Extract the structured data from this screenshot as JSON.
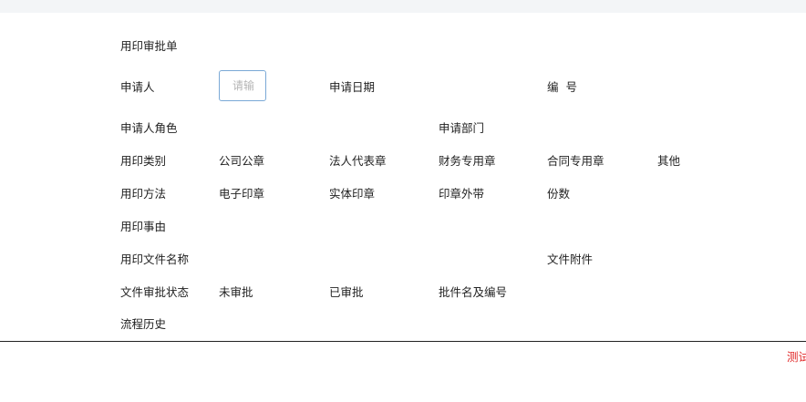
{
  "form": {
    "title": "用印审批单",
    "applicant_label": "申请人",
    "applicant_input": {
      "placeholder": "请输",
      "value": ""
    },
    "apply_date_label": "申请日期",
    "number_label": "编  号",
    "applicant_role_label": "申请人角色",
    "apply_dept_label": "申请部门",
    "seal_type": {
      "label": "用印类别",
      "options": [
        "公司公章",
        "法人代表章",
        "财务专用章",
        "合同专用章",
        "其他"
      ]
    },
    "seal_method": {
      "label": "用印方法",
      "options": [
        "电子印章",
        "实体印章",
        "印章外带"
      ]
    },
    "copies_label": "份数",
    "reason_label": "用印事由",
    "doc_name_label": "用印文件名称",
    "attachment_label": "文件附件",
    "review_status": {
      "label": "文件审批状态",
      "options": [
        "未审批",
        "已审批"
      ]
    },
    "approved_doc_label": "批件名及编号",
    "history_label": "流程历史"
  },
  "footer": {
    "partial_text": "测试"
  },
  "colors": {
    "input_border": "#7aa9d6",
    "topbar": "#f3f5f7",
    "red_text": "#e02424"
  }
}
